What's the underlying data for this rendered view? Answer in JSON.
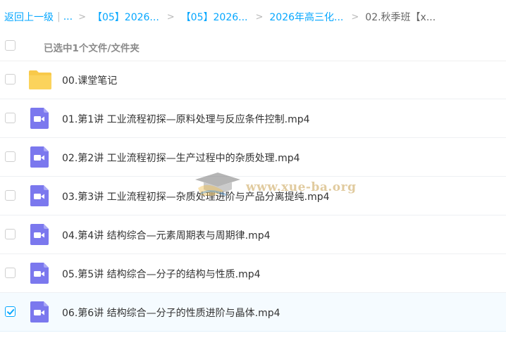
{
  "breadcrumb": {
    "back_label": "返回上一级",
    "pipe": "|",
    "ellipsis": "...",
    "separator": ">",
    "items": [
      "【05】2026...",
      "【05】2026...",
      "2026年高三化..."
    ],
    "current": "02.秋季班【x..."
  },
  "header": {
    "selection_label": "已选中1个文件/文件夹"
  },
  "files": [
    {
      "name": "00.课堂笔记",
      "type": "folder",
      "checked": false
    },
    {
      "name": "01.第1讲 工业流程初探—原料处理与反应条件控制.mp4",
      "type": "video",
      "checked": false
    },
    {
      "name": "02.第2讲 工业流程初探—生产过程中的杂质处理.mp4",
      "type": "video",
      "checked": false
    },
    {
      "name": "03.第3讲 工业流程初探—杂质处理进阶与产品分离提纯.mp4",
      "type": "video",
      "checked": false
    },
    {
      "name": "04.第4讲 结构综合—元素周期表与周期律.mp4",
      "type": "video",
      "checked": false
    },
    {
      "name": "05.第5讲 结构综合—分子的结构与性质.mp4",
      "type": "video",
      "checked": false
    },
    {
      "name": "06.第6讲 结构综合—分子的性质进阶与晶体.mp4",
      "type": "video",
      "checked": true
    }
  ],
  "icons": {
    "folder": "folder-icon",
    "video": "video-file-icon",
    "check": "check-icon"
  },
  "colors": {
    "accent": "#06a7ff",
    "folder": "#f8c94a",
    "video": "#7b78ee",
    "text": "#333333",
    "muted": "#8a8a8a"
  },
  "watermark": {
    "text": "www.xue-ba.org"
  }
}
